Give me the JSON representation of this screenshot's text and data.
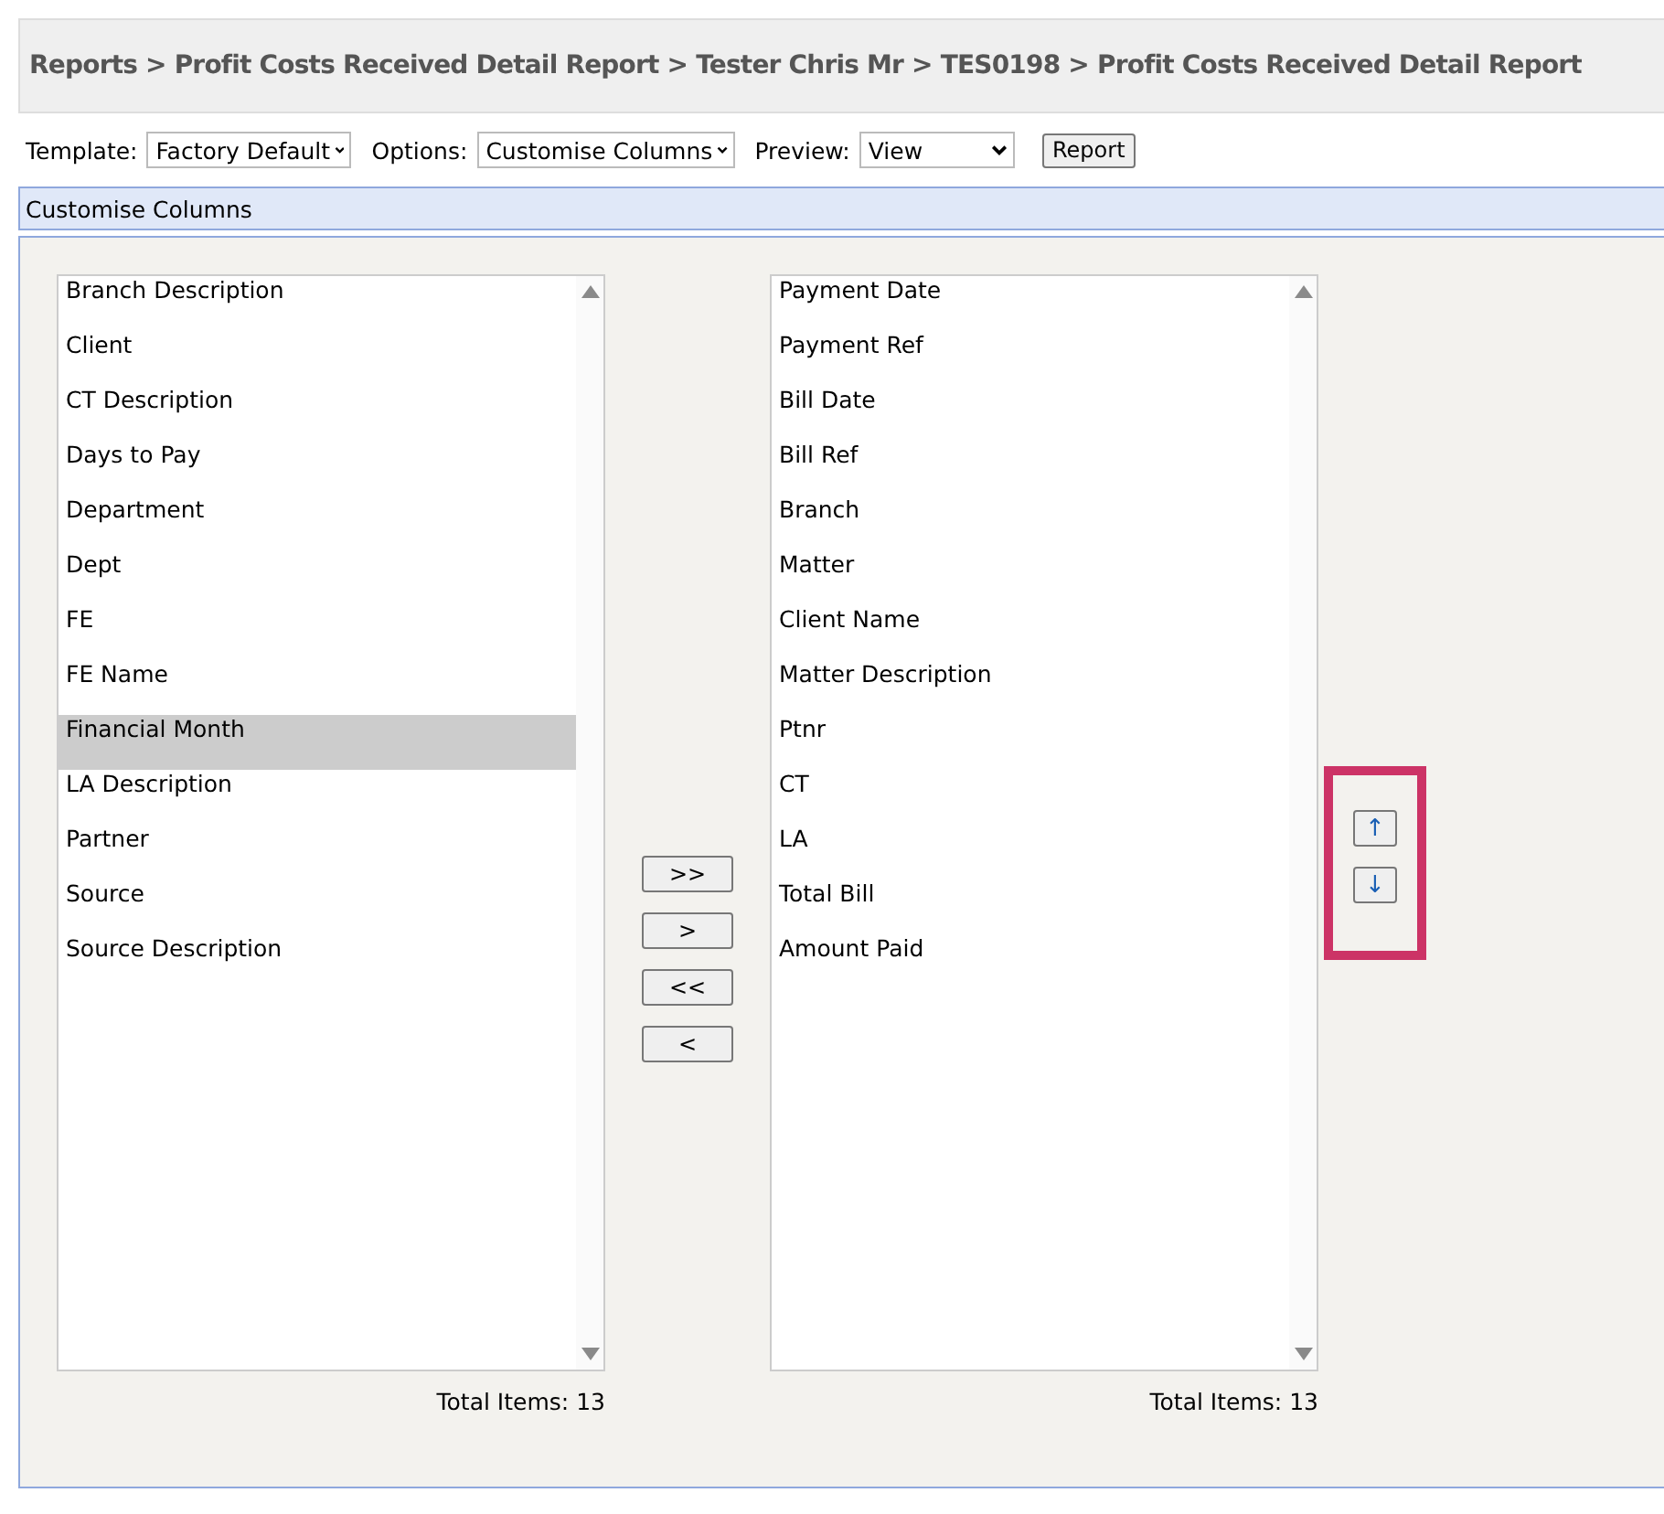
{
  "breadcrumb": "Reports > Profit Costs Received Detail Report > Tester Chris Mr > TES0198 > Profit Costs Received Detail Report",
  "toolbar": {
    "template": {
      "label": "Template:",
      "value": "Factory Default"
    },
    "options": {
      "label": "Options:",
      "value": "Customise Columns"
    },
    "preview": {
      "label": "Preview:",
      "value": "View"
    },
    "report_button": "Report"
  },
  "section_title": "Customise Columns",
  "available": {
    "items": [
      {
        "label": "Branch Description",
        "selected": false
      },
      {
        "label": "Client",
        "selected": false
      },
      {
        "label": "CT Description",
        "selected": false
      },
      {
        "label": "Days to Pay",
        "selected": false
      },
      {
        "label": "Department",
        "selected": false
      },
      {
        "label": "Dept",
        "selected": false
      },
      {
        "label": "FE",
        "selected": false
      },
      {
        "label": "FE Name",
        "selected": false
      },
      {
        "label": "Financial Month",
        "selected": true
      },
      {
        "label": "LA Description",
        "selected": false
      },
      {
        "label": "Partner",
        "selected": false
      },
      {
        "label": "Source",
        "selected": false
      },
      {
        "label": "Source Description",
        "selected": false
      }
    ],
    "total": "Total Items: 13"
  },
  "move_buttons": [
    ">>",
    ">",
    "<<",
    "<"
  ],
  "chosen": {
    "items": [
      {
        "label": "Payment Date",
        "selected": false
      },
      {
        "label": "Payment Ref",
        "selected": false
      },
      {
        "label": "Bill Date",
        "selected": false
      },
      {
        "label": "Bill Ref",
        "selected": false
      },
      {
        "label": "Branch",
        "selected": false
      },
      {
        "label": "Matter",
        "selected": false
      },
      {
        "label": "Client Name",
        "selected": false
      },
      {
        "label": "Matter Description",
        "selected": false
      },
      {
        "label": "Ptnr",
        "selected": false
      },
      {
        "label": "CT",
        "selected": false
      },
      {
        "label": "LA",
        "selected": false
      },
      {
        "label": "Total Bill",
        "selected": false
      },
      {
        "label": "Amount Paid",
        "selected": false
      }
    ],
    "total": "Total Items: 13"
  },
  "order_buttons": [
    "↑",
    "↓"
  ]
}
